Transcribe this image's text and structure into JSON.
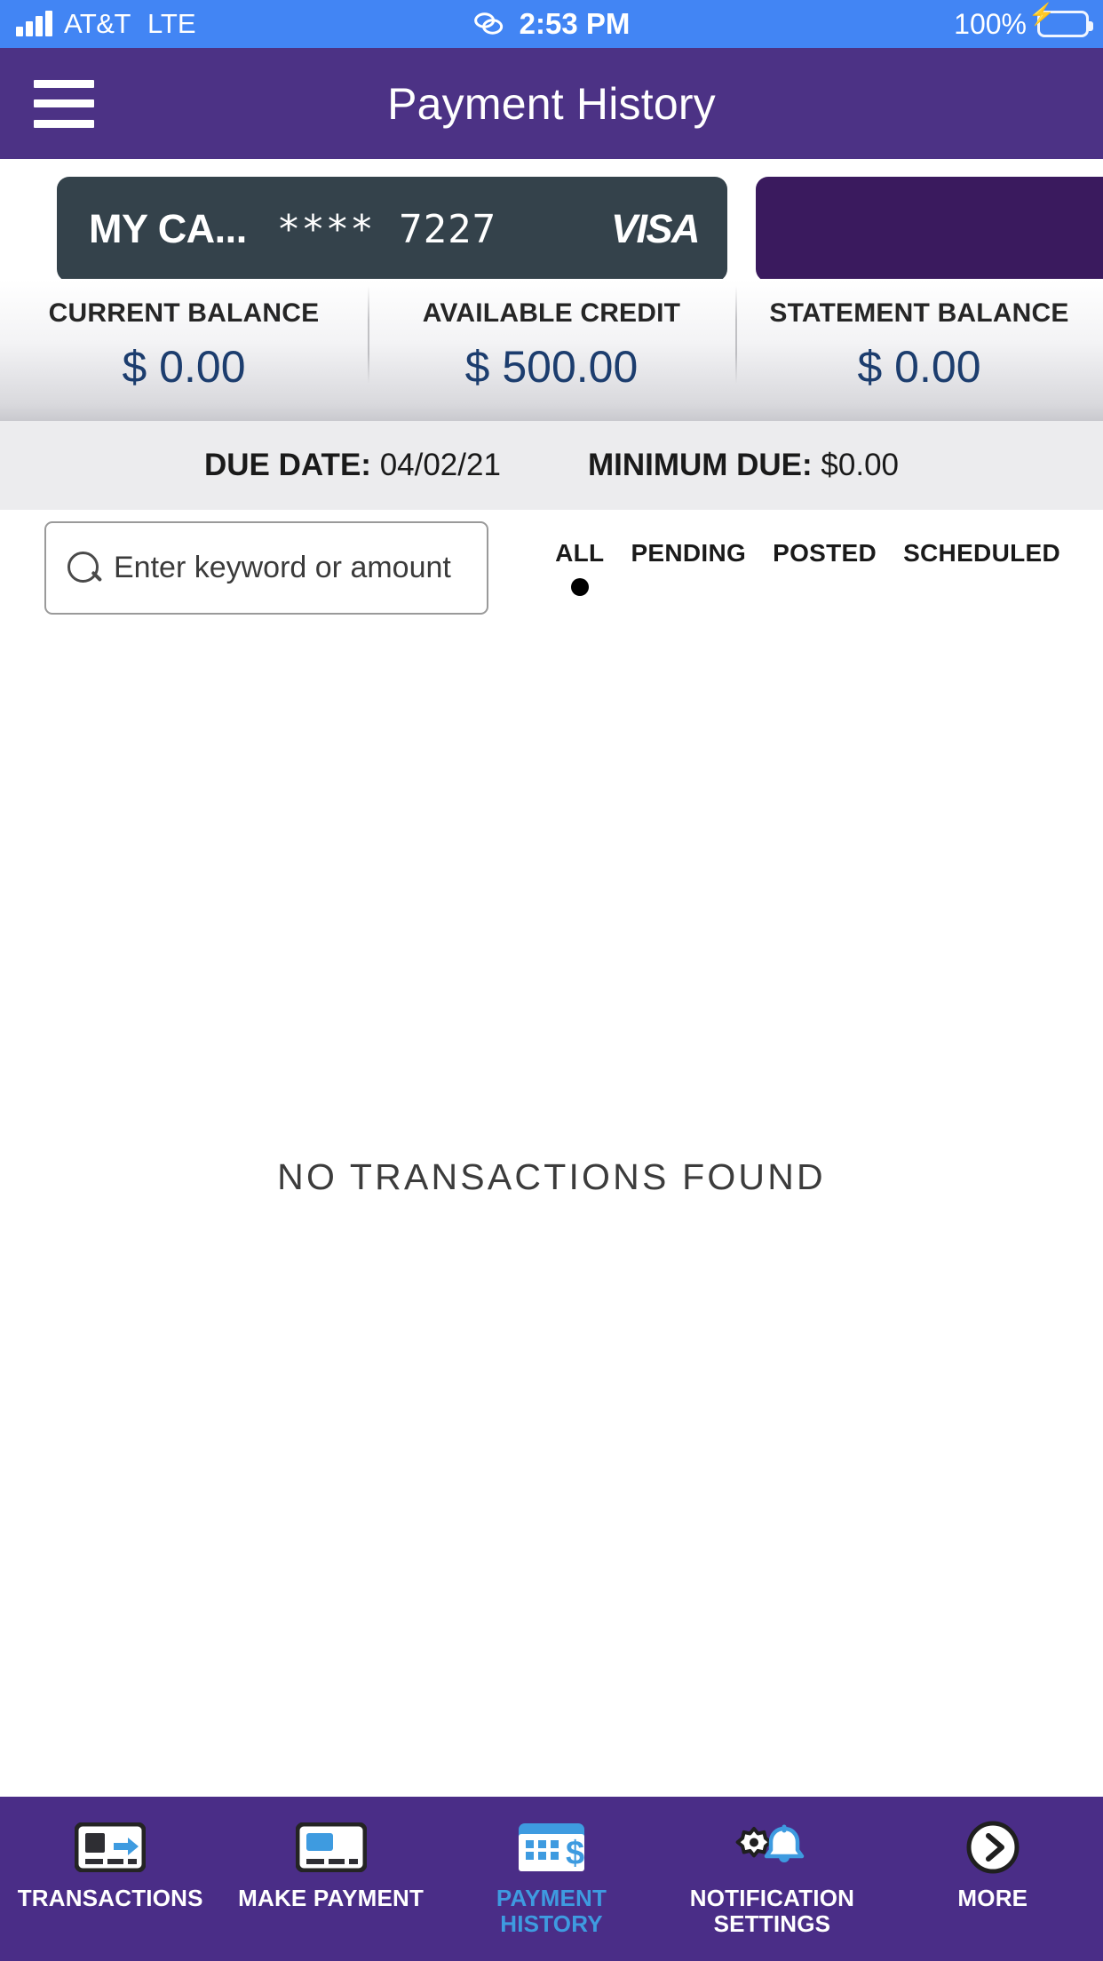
{
  "statusbar": {
    "carrier": "AT&T",
    "network": "LTE",
    "time": "2:53 PM",
    "battery_pct": "100%",
    "link_icon": "link-icon",
    "signal_icon": "signal-bars-icon",
    "battery_icon": "battery-charging-icon"
  },
  "header": {
    "menu_icon": "hamburger-menu-icon",
    "title": "Payment History",
    "background": "#4C3285"
  },
  "cards": [
    {
      "name": "MY CA...",
      "masked_number": "**** 7227",
      "brand": "VISA",
      "background": "#34424B"
    },
    {
      "name": "",
      "masked_number": "",
      "brand": "",
      "background": "#3A1A5E"
    }
  ],
  "balances": [
    {
      "label": "CURRENT BALANCE",
      "value": "$ 0.00"
    },
    {
      "label": "AVAILABLE CREDIT",
      "value": "$ 500.00"
    },
    {
      "label": "STATEMENT BALANCE",
      "value": "$ 0.00"
    }
  ],
  "balance_value_color": "#1C3D6E",
  "due": {
    "due_date_label": "DUE DATE:",
    "due_date_value": "04/02/21",
    "minimum_due_label": "MINIMUM DUE:",
    "minimum_due_value": "$0.00"
  },
  "search": {
    "placeholder": "Enter keyword or amount",
    "value": "",
    "icon": "search-icon"
  },
  "filters": [
    {
      "label": "ALL",
      "active": true
    },
    {
      "label": "PENDING",
      "active": false
    },
    {
      "label": "POSTED",
      "active": false
    },
    {
      "label": "SCHEDULED",
      "active": false
    }
  ],
  "empty_state": {
    "message": "NO TRANSACTIONS FOUND"
  },
  "bottom_nav": {
    "background": "#4A2D87",
    "active_color": "#3E9BE0",
    "items": [
      {
        "label": "TRANSACTIONS",
        "icon": "card-arrow-icon",
        "active": false
      },
      {
        "label": "MAKE PAYMENT",
        "icon": "credit-card-icon",
        "active": false
      },
      {
        "label": "PAYMENT\nHISTORY",
        "label_line1": "PAYMENT",
        "label_line2": "HISTORY",
        "icon": "calendar-dollar-icon",
        "active": true
      },
      {
        "label": "NOTIFICATION\nSETTINGS",
        "label_line1": "NOTIFICATION",
        "label_line2": "SETTINGS",
        "icon": "gear-bell-icon",
        "active": false
      },
      {
        "label": "MORE",
        "icon": "chevron-right-circle-icon",
        "active": false
      }
    ]
  }
}
